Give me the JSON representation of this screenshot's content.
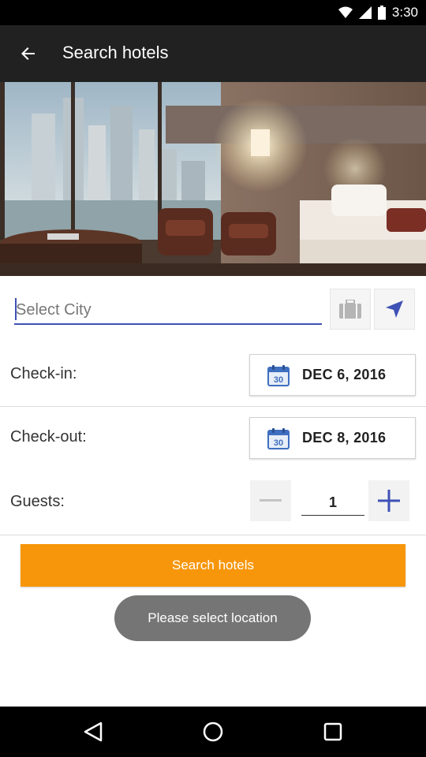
{
  "status_bar": {
    "time": "3:30"
  },
  "app_bar": {
    "title": "Search hotels"
  },
  "city": {
    "placeholder": "Select City",
    "value": ""
  },
  "check_in": {
    "label": "Check-in:",
    "date": "DEC 6, 2016",
    "calendar_day": "30"
  },
  "check_out": {
    "label": "Check-out:",
    "date": "DEC 8, 2016",
    "calendar_day": "30"
  },
  "guests": {
    "label": "Guests:",
    "count": "1"
  },
  "search_button": {
    "label": "Search hotels"
  },
  "toast": {
    "message": "Please select location"
  },
  "colors": {
    "app_bar": "#212121",
    "accent": "#3f51b5",
    "button": "#f7960a",
    "toast": "#757575"
  },
  "icons": {
    "back": "arrow-left-icon",
    "suitcase": "suitcase-icon",
    "locate": "navigation-arrow-icon",
    "calendar": "calendar-icon",
    "minus": "minus-icon",
    "plus": "plus-icon",
    "nav_back": "triangle-back-icon",
    "nav_home": "circle-home-icon",
    "nav_recents": "square-recents-icon"
  }
}
